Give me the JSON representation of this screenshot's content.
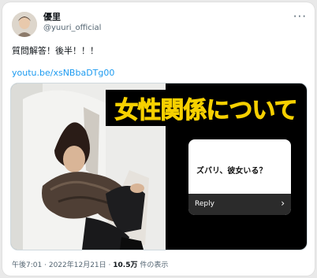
{
  "tweet": {
    "display_name": "優里",
    "handle": "@yuuri_official",
    "more_icon": "more-horizontal-icon",
    "text": "質問解答！後半！！！",
    "link": "youtu.be/xsNBbaDTg00",
    "time": "午後7:01",
    "separator": "·",
    "date": "2022年12月21日",
    "views_count": "10.5万",
    "views_label": "件の表示"
  },
  "media": {
    "banner_text": "女性関係について",
    "question_text": "ズバリ、彼女いる？",
    "reply_label": "Reply",
    "reply_arrow_icon": "chevron-right-icon",
    "banner_color": "#f6d000"
  }
}
